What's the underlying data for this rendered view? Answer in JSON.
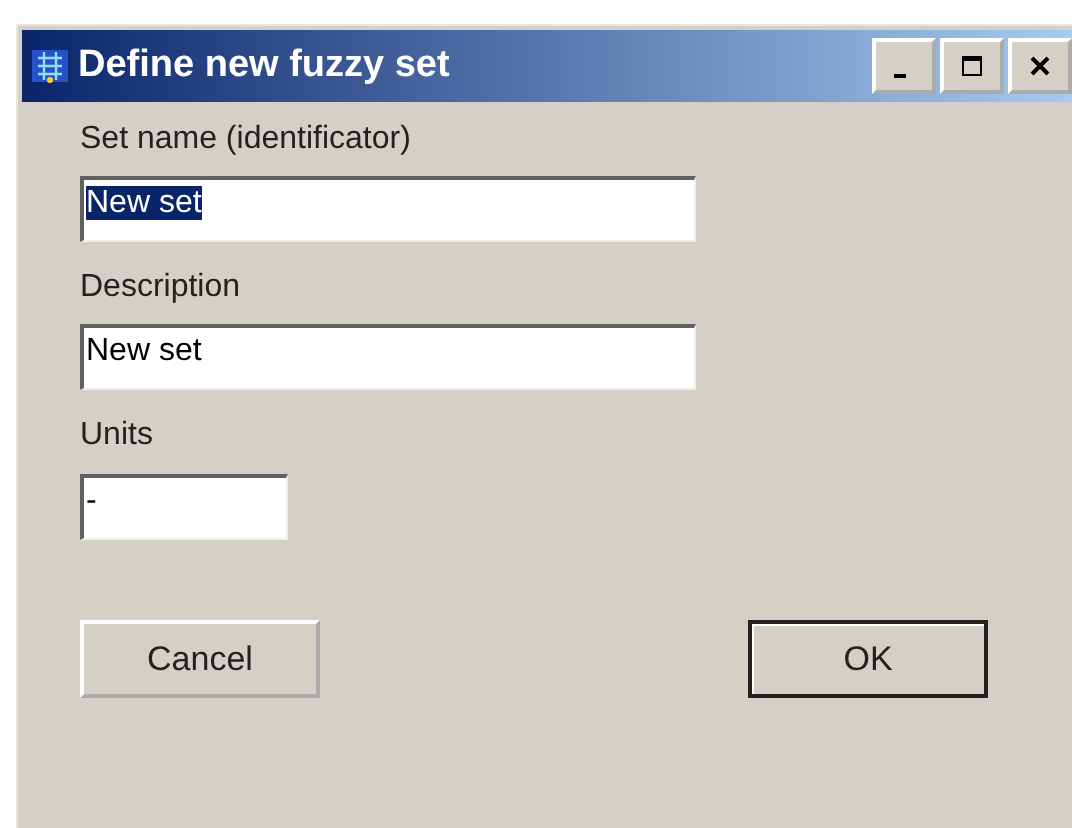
{
  "window": {
    "title": "Define new fuzzy set",
    "controls": [
      {
        "kind": "minimize"
      },
      {
        "kind": "maximize"
      },
      {
        "kind": "close"
      }
    ]
  },
  "fields": [
    {
      "label": "Set name (identificator)",
      "value": "New set",
      "text_selected": true,
      "kind": "wide"
    },
    {
      "label": "Description",
      "value": "New set",
      "text_selected": false,
      "kind": "wide"
    },
    {
      "label": "Units",
      "value": "-",
      "text_selected": false,
      "kind": "narrow"
    }
  ],
  "buttons": [
    {
      "label": "Cancel",
      "default": false
    },
    {
      "label": "OK",
      "default": true
    }
  ]
}
